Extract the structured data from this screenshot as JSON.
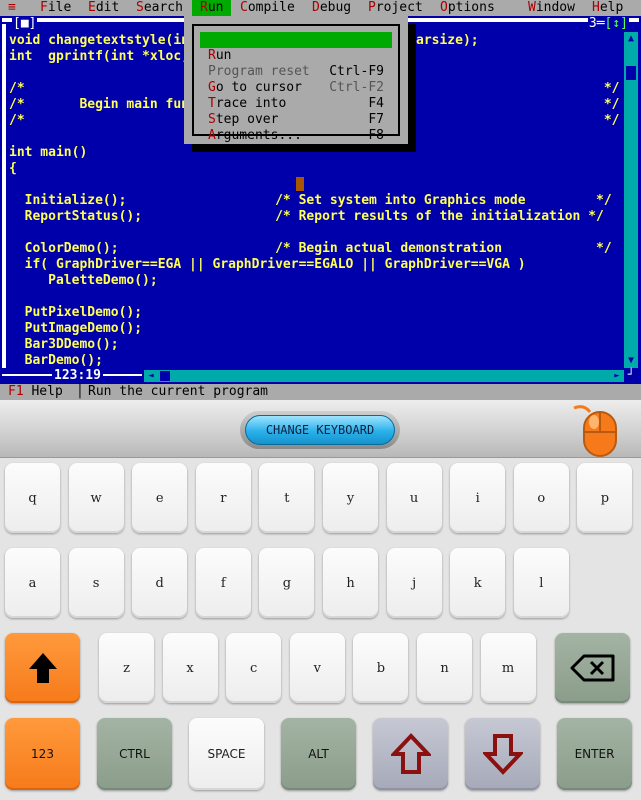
{
  "menubar": {
    "system_menu": "≡",
    "items": [
      {
        "label": "File",
        "hotkey": "F",
        "rest": "ile"
      },
      {
        "label": "Edit",
        "hotkey": "E",
        "rest": "dit"
      },
      {
        "label": "Search",
        "hotkey": "S",
        "rest": "earch"
      },
      {
        "label": "Run",
        "hotkey": "R",
        "rest": "un"
      },
      {
        "label": "Compile",
        "hotkey": "C",
        "rest": "ompile"
      },
      {
        "label": "Debug",
        "hotkey": "D",
        "rest": "ebug"
      },
      {
        "label": "Project",
        "hotkey": "P",
        "rest": "roject"
      },
      {
        "label": "Options",
        "hotkey": "O",
        "rest": "ptions"
      },
      {
        "label": "Window",
        "hotkey": "W",
        "rest": "indow"
      },
      {
        "label": "Help",
        "hotkey": "H",
        "rest": "elp"
      }
    ],
    "active": "Run"
  },
  "editor": {
    "close_box": "[■]",
    "window_number": "3",
    "zoom_box": "[↕]",
    "code_lines": [
      "void changetextstyle(int font, int direction, int charsize);",
      "int  gprintf(int *xloc, int *yloc, char *fmt, ... );",
      "",
      "/*                                                                          */",
      "/*       Begin main function                                                */",
      "/*                                                                          */",
      "",
      "int main()",
      "{",
      "",
      "  Initialize();                   /* Set system into Graphics mode         */",
      "  ReportStatus();                 /* Report results of the initialization */",
      "",
      "  ColorDemo();                    /* Begin actual demonstration            */",
      "  if( GraphDriver==EGA || GraphDriver==EGALO || GraphDriver==VGA )",
      "     PaletteDemo();",
      "",
      "  PutPixelDemo();",
      "  PutImageDemo();",
      "  Bar3DDemo();",
      "  BarDemo();"
    ],
    "cursor_position": "123:19",
    "scroll_up": "▲",
    "scroll_down": "▼",
    "scroll_left": "◄",
    "scroll_right": "►",
    "corner": "┘"
  },
  "run_menu": {
    "items": [
      {
        "hotkey": "R",
        "rest": "un",
        "shortcut": "Ctrl-F9",
        "state": "selected"
      },
      {
        "hotkey": "",
        "rest": "Program reset",
        "shortcut": "Ctrl-F2",
        "state": "disabled"
      },
      {
        "hotkey": "G",
        "rest": "o to cursor",
        "shortcut": "F4",
        "state": "normal"
      },
      {
        "hotkey": "T",
        "rest": "race into",
        "shortcut": "F7",
        "state": "normal"
      },
      {
        "hotkey": "S",
        "rest": "tep over",
        "shortcut": "F8",
        "state": "normal"
      },
      {
        "hotkey": "A",
        "rest": "rguments...",
        "shortcut": "",
        "state": "normal"
      }
    ]
  },
  "statusbar": {
    "f1_key": "F1",
    "f1_label": " Help",
    "separator": "│",
    "message": "Run the current program"
  },
  "keyboard": {
    "change_keyboard": "CHANGE KEYBOARD",
    "mouse_icon": "mouse-icon",
    "row1": [
      "q",
      "w",
      "e",
      "r",
      "t",
      "y",
      "u",
      "i",
      "o",
      "p"
    ],
    "row2": [
      "a",
      "s",
      "d",
      "f",
      "g",
      "h",
      "j",
      "k",
      "l"
    ],
    "row3": [
      "z",
      "x",
      "c",
      "v",
      "b",
      "n",
      "m"
    ],
    "shift_icon": "shift-up-arrow-icon",
    "backspace_icon": "backspace-icon",
    "row4": {
      "num": "123",
      "ctrl": "CTRL",
      "space": "SPACE",
      "alt": "ALT",
      "up_icon": "up-arrow-icon",
      "down_icon": "down-arrow-icon",
      "enter": "ENTER"
    },
    "colors": {
      "orange": "#f67a1a",
      "gray_green": "#8a9c8a",
      "arrow_red": "#8b1010",
      "ide_blue": "#0000aa",
      "code_yellow": "#ffff55"
    }
  }
}
